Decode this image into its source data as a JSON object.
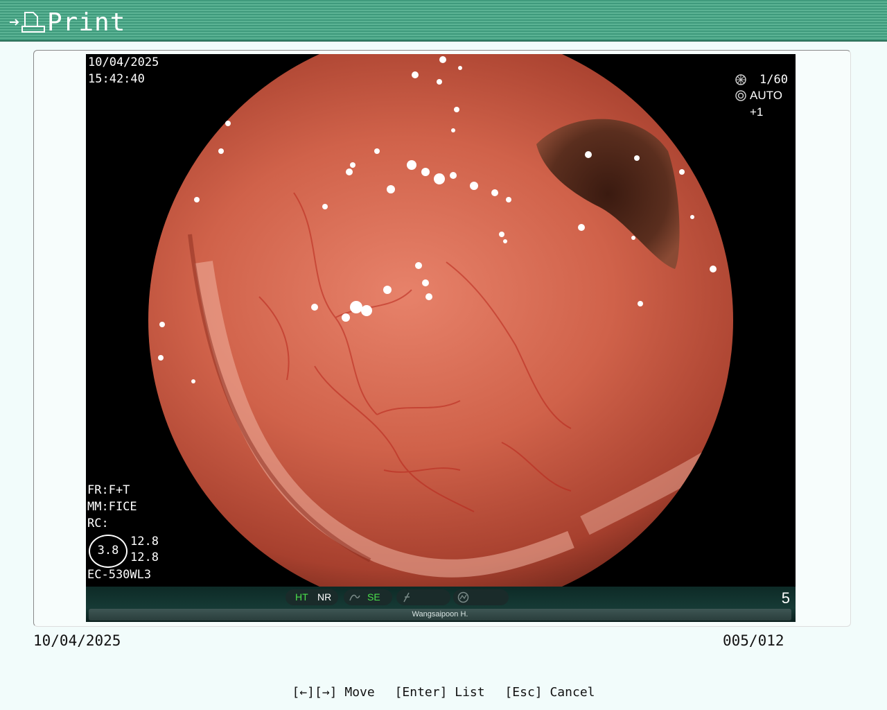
{
  "header": {
    "title": "Print",
    "icon": "print-icon"
  },
  "image": {
    "date": "10/04/2025",
    "time": "15:42:40",
    "shutter": "1/60",
    "iris": "AUTO +1",
    "fr": "FR:F+T",
    "mm": "MM:FICE",
    "rc": "RC:",
    "circle_value": "3.8",
    "value_top": "12.8",
    "value_bottom": "12.8",
    "scope_model": "EC-530WL3"
  },
  "status": {
    "ht": "HT",
    "nr": "NR",
    "se": "SE",
    "page": "5",
    "patient": "Wangsaipoon H.",
    "accent_green": "#4be04b"
  },
  "footer": {
    "date": "10/04/2025",
    "count": "005/012"
  },
  "hints": {
    "move": "[←][→] Move",
    "list": "[Enter] List",
    "cancel": "[Esc] Cancel"
  }
}
